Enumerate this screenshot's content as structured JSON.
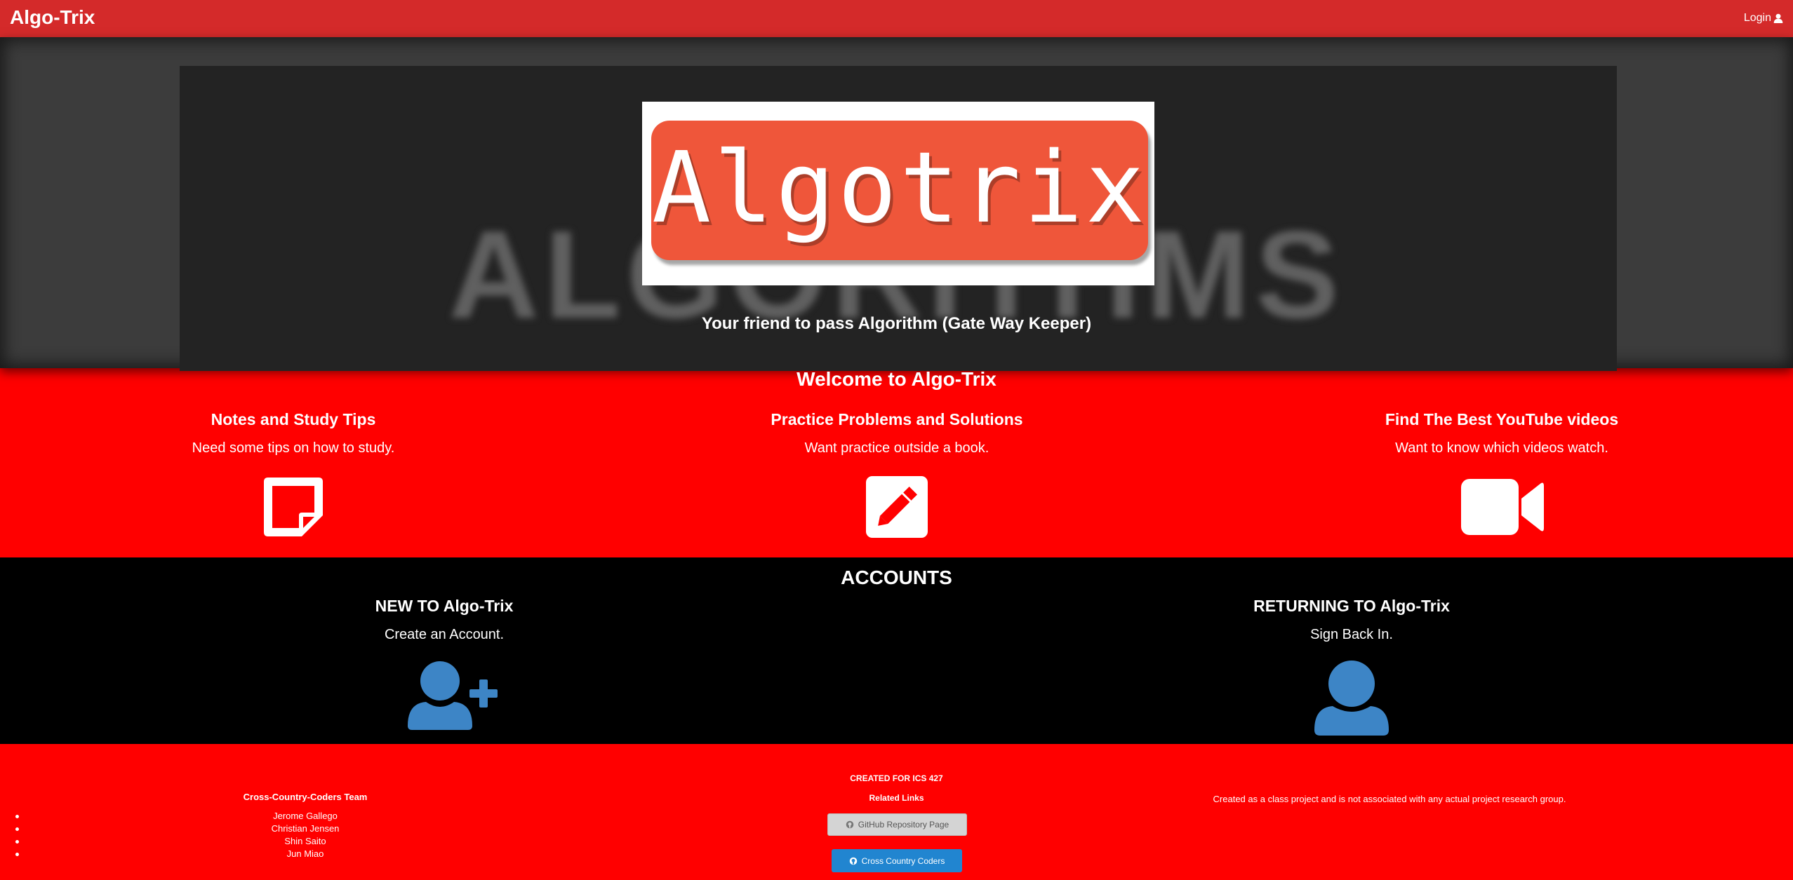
{
  "navbar": {
    "brand": "Algo-Trix",
    "login_label": "Login"
  },
  "hero": {
    "background_word": "ALGORITHMS",
    "logo_text": "Algotrix",
    "tagline": "Your friend to pass Algorithm (Gate Way Keeper)"
  },
  "welcome": {
    "title": "Welcome to Algo-Trix",
    "features": [
      {
        "title": "Notes and Study Tips",
        "subtitle": "Need some tips on how to study.",
        "icon": "sticky-note-icon"
      },
      {
        "title": "Practice Problems and Solutions",
        "subtitle": "Want practice outside a book.",
        "icon": "pencil-square-icon"
      },
      {
        "title": "Find The Best YouTube videos",
        "subtitle": "Want to know which videos watch.",
        "icon": "video-camera-icon"
      }
    ]
  },
  "accounts": {
    "title": "ACCOUNTS",
    "new": {
      "title": "NEW TO Algo-Trix",
      "subtitle": "Create an Account.",
      "icon": "add-user-icon"
    },
    "returning": {
      "title": "RETURNING TO Algo-Trix",
      "subtitle": "Sign Back In.",
      "icon": "user-icon"
    }
  },
  "footer": {
    "team_title": "Cross-Country-Coders Team",
    "team_members": [
      "Jerome Gallego",
      "Christian Jensen",
      "Shin Saito",
      "Jun Miao"
    ],
    "created_for": "CREATED FOR ICS 427",
    "related_links": "Related Links",
    "github_button": "GitHub Repository Page",
    "ccc_button": "Cross Country Coders",
    "disclaimer": "Created as a class project and is not associated with any actual project research group."
  },
  "colors": {
    "navbar": "#d42a2a",
    "red_band": "#ff0000",
    "logo_orange": "#ef563a",
    "icon_blue": "#3d85c6",
    "button_blue": "#2185d0"
  }
}
